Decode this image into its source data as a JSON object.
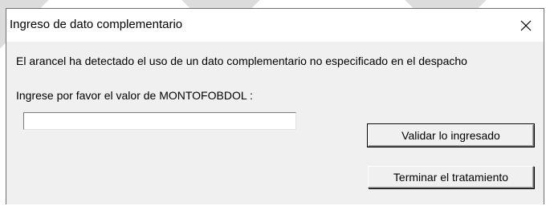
{
  "window": {
    "title": "Ingreso de dato complementario"
  },
  "icons": {
    "close": "close-icon"
  },
  "dialog": {
    "message": "El arancel ha detectado el uso de un dato complementario no especificado en el despacho",
    "prompt": "Ingrese por favor el valor de MONTOFOBDOL :",
    "input_value": "",
    "validate_label": "Validar lo ingresado",
    "terminate_label": "Terminar el tratamiento"
  },
  "colors": {
    "dialog_background": "#f0f0f0",
    "titlebar_background": "#ffffff",
    "border": "#6e6e6e"
  }
}
